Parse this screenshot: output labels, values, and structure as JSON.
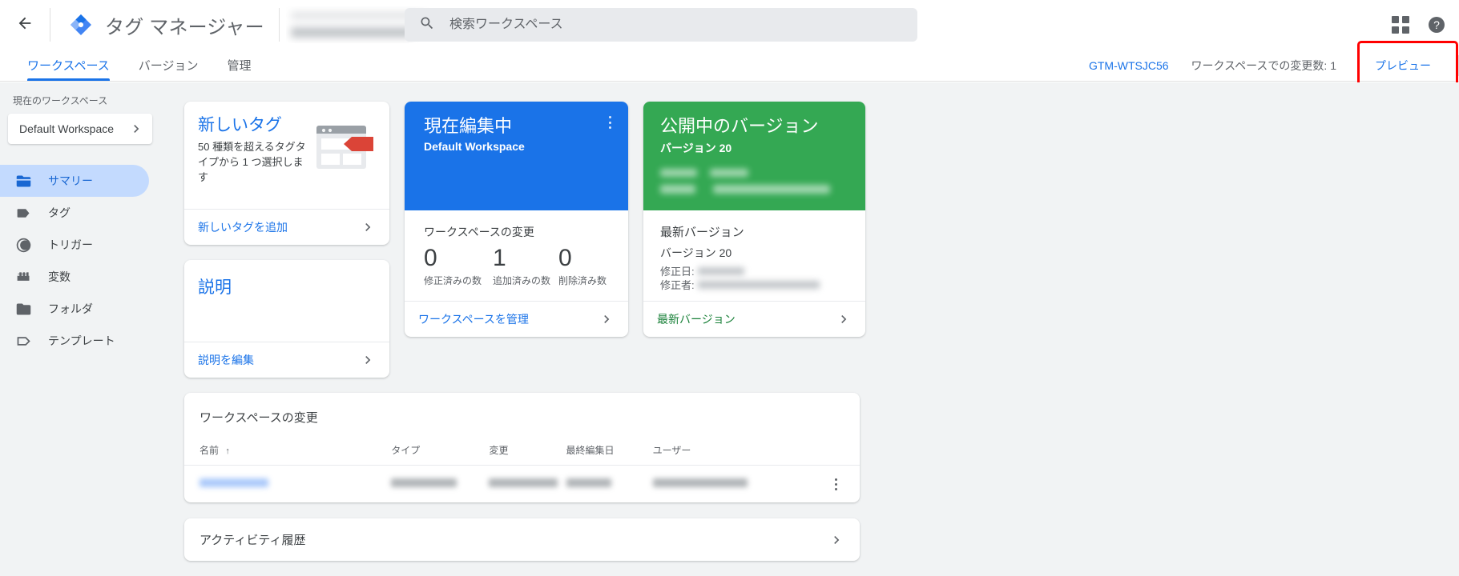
{
  "header": {
    "back_icon": "back-arrow-icon",
    "logo_icon": "tag-manager-logo-icon",
    "title": "タグ マネージャー",
    "account_redacted": true,
    "search": {
      "icon": "search-icon",
      "placeholder": "検索ワークスペース",
      "value": ""
    },
    "apps_icon": "apps-grid-icon",
    "help_icon": "help-circle-icon"
  },
  "tabs": [
    {
      "label": "ワークスペース",
      "active": true
    },
    {
      "label": "バージョン",
      "active": false
    },
    {
      "label": "管理",
      "active": false
    }
  ],
  "tabbar_right": {
    "container_id": "GTM-WTSJC56",
    "changes_label": "ワークスペースでの変更数: 1",
    "preview_label": "プレビュー",
    "highlight_color": "#ff0000"
  },
  "sidebar": {
    "workspace_label": "現在のワークスペース",
    "workspace_name": "Default Workspace",
    "workspace_chevron_icon": "chevron-right-icon",
    "items": [
      {
        "label": "サマリー",
        "icon": "summary-icon",
        "active": true
      },
      {
        "label": "タグ",
        "icon": "tag-icon",
        "active": false
      },
      {
        "label": "トリガー",
        "icon": "trigger-icon",
        "active": false
      },
      {
        "label": "変数",
        "icon": "variable-icon",
        "active": false
      },
      {
        "label": "フォルダ",
        "icon": "folder-icon",
        "active": false
      },
      {
        "label": "テンプレート",
        "icon": "template-icon",
        "active": false
      }
    ]
  },
  "cards": {
    "new_tag": {
      "title": "新しいタグ",
      "description": "50 種類を超えるタグタイプから 1 つ選択します",
      "graphic_icon": "new-tag-illustration-icon",
      "action_label": "新しいタグを追加",
      "action_chevron_icon": "chevron-right-icon"
    },
    "description": {
      "title": "説明",
      "body": "",
      "action_label": "説明を編集",
      "action_chevron_icon": "chevron-right-icon"
    },
    "editing": {
      "banner_title": "現在編集中",
      "banner_subtitle": "Default Workspace",
      "banner_color": "#1a73e8",
      "menu_icon": "kebab-menu-icon",
      "stats_title": "ワークスペースの変更",
      "stats": [
        {
          "value": "0",
          "caption": "修正済みの数"
        },
        {
          "value": "1",
          "caption": "追加済みの数"
        },
        {
          "value": "0",
          "caption": "削除済み数"
        }
      ],
      "action_label": "ワークスペースを管理",
      "action_chevron_icon": "chevron-right-icon"
    },
    "published": {
      "banner_title": "公開中のバージョン",
      "banner_subtitle": "バージョン 20",
      "banner_color": "#34a853",
      "banner_meta_redacted": true,
      "latest_title": "最新バージョン",
      "latest_version": "バージョン 20",
      "modified_date_label": "修正日:",
      "modified_by_label": "修正者:",
      "modified_date_value_redacted": true,
      "modified_by_value_redacted": true,
      "action_label": "最新バージョン",
      "action_chevron_icon": "chevron-right-icon"
    }
  },
  "changes_table": {
    "title": "ワークスペースの変更",
    "columns": [
      {
        "label": "名前",
        "sorted": true,
        "sort_icon": "↑"
      },
      {
        "label": "タイプ",
        "sorted": false
      },
      {
        "label": "変更",
        "sorted": false
      },
      {
        "label": "最終編集日",
        "sorted": false
      },
      {
        "label": "ユーザー",
        "sorted": false
      }
    ],
    "rows": [
      {
        "name_redacted": true,
        "type_redacted": true,
        "change_redacted": true,
        "date_redacted": true,
        "user_redacted": true,
        "menu_icon": "kebab-menu-icon"
      }
    ]
  },
  "activity": {
    "label": "アクティビティ履歴",
    "chevron_icon": "chevron-right-icon"
  }
}
